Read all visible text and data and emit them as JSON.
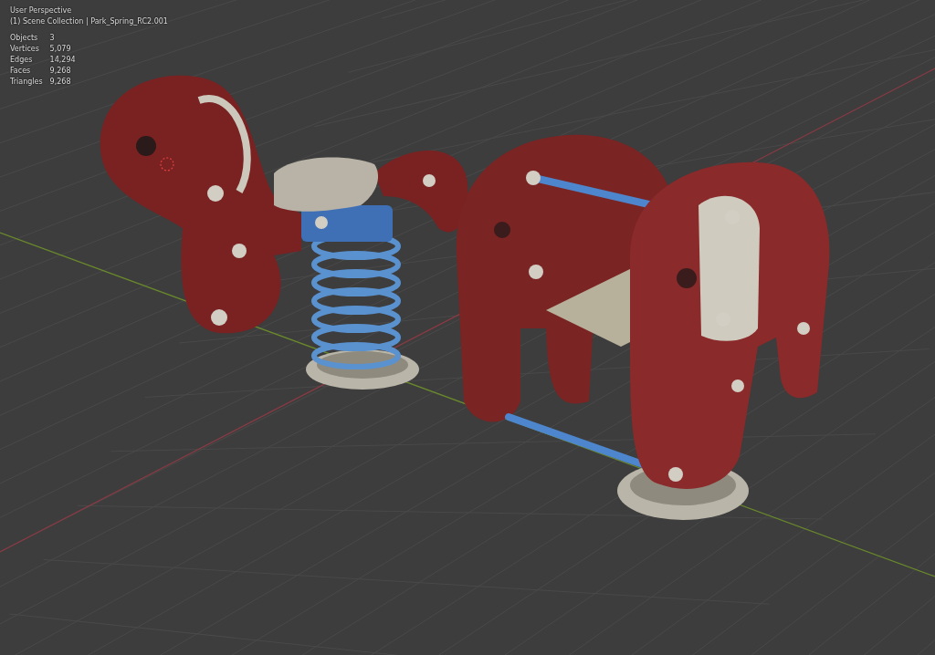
{
  "viewport": {
    "view_name": "User Perspective",
    "collection": "(1) Scene Collection | Park_Spring_RC2.001"
  },
  "statistics": [
    {
      "label": "Objects",
      "value": "3"
    },
    {
      "label": "Vertices",
      "value": "5,079"
    },
    {
      "label": "Edges",
      "value": "14,294"
    },
    {
      "label": "Faces",
      "value": "9,268"
    },
    {
      "label": "Triangles",
      "value": "9,268"
    }
  ]
}
